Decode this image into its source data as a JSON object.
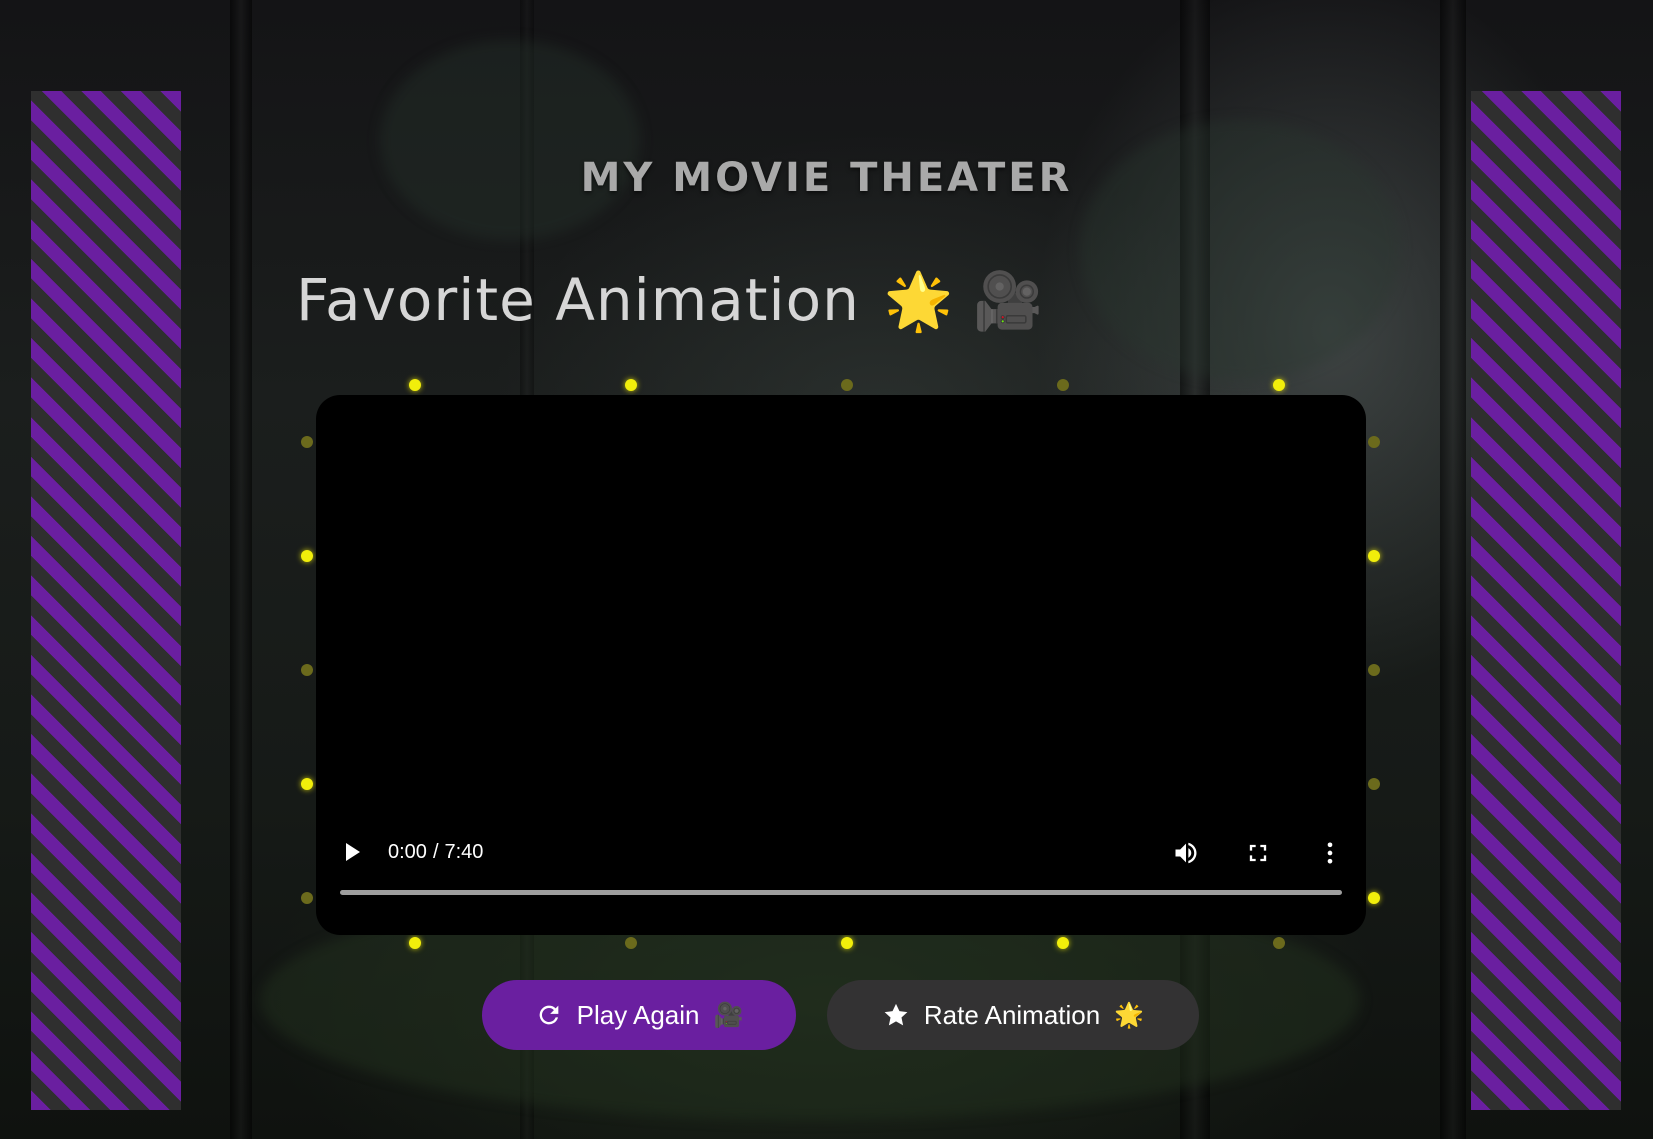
{
  "header": {
    "site_title": "MY MOVIE THEATER",
    "heading": "Favorite Animation",
    "heading_emojis": "🌟 🎥"
  },
  "player": {
    "current_time": "0:00",
    "separator": "/",
    "duration": "7:40",
    "progress_fraction": 0,
    "icons": [
      "play-icon",
      "volume-icon",
      "fullscreen-icon",
      "more-options-icon"
    ]
  },
  "actions": {
    "play_again_label": "Play Again",
    "play_again_emoji": "🎥",
    "rate_label": "Rate Animation",
    "rate_emoji": "🌟"
  },
  "colors": {
    "accent_purple": "#6a1fa0",
    "secondary_button": "#333233",
    "bulb_on": "#f1ee0b",
    "bulb_dim": "#6b6a1c",
    "curtain_stripe_dark": "#2f2f2f"
  }
}
